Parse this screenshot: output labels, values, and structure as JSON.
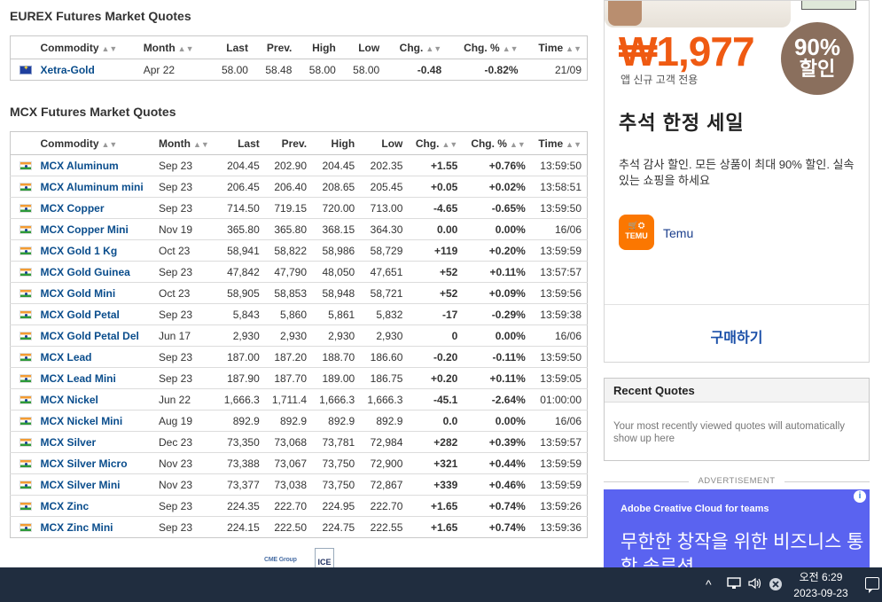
{
  "eurex": {
    "title": "EUREX Futures Market Quotes",
    "headers": {
      "commodity": "Commodity",
      "month": "Month",
      "last": "Last",
      "prev": "Prev.",
      "high": "High",
      "low": "Low",
      "chg": "Chg.",
      "chgpct": "Chg. %",
      "time": "Time"
    },
    "rows": [
      {
        "name": "Xetra-Gold",
        "month": "Apr 22",
        "last": "58.00",
        "prev": "58.48",
        "high": "58.00",
        "low": "58.00",
        "chg": "-0.48",
        "chgpct": "-0.82%",
        "time": "21/09",
        "dir": "down"
      }
    ]
  },
  "mcx": {
    "title": "MCX Futures Market Quotes",
    "headers": {
      "commodity": "Commodity",
      "month": "Month",
      "last": "Last",
      "prev": "Prev.",
      "high": "High",
      "low": "Low",
      "chg": "Chg.",
      "chgpct": "Chg. %",
      "time": "Time"
    },
    "rows": [
      {
        "name": "MCX Aluminum",
        "month": "Sep 23",
        "last": "204.45",
        "prev": "202.90",
        "high": "204.45",
        "low": "202.35",
        "chg": "+1.55",
        "chgpct": "+0.76%",
        "time": "13:59:50",
        "dir": "up"
      },
      {
        "name": "MCX Aluminum mini",
        "month": "Sep 23",
        "last": "206.45",
        "prev": "206.40",
        "high": "208.65",
        "low": "205.45",
        "chg": "+0.05",
        "chgpct": "+0.02%",
        "time": "13:58:51",
        "dir": "up"
      },
      {
        "name": "MCX Copper",
        "month": "Sep 23",
        "last": "714.50",
        "prev": "719.15",
        "high": "720.00",
        "low": "713.00",
        "chg": "-4.65",
        "chgpct": "-0.65%",
        "time": "13:59:50",
        "dir": "down"
      },
      {
        "name": "MCX Copper Mini",
        "month": "Nov 19",
        "last": "365.80",
        "prev": "365.80",
        "high": "368.15",
        "low": "364.30",
        "chg": "0.00",
        "chgpct": "0.00%",
        "time": "16/06",
        "dir": "flat"
      },
      {
        "name": "MCX Gold 1 Kg",
        "month": "Oct 23",
        "last": "58,941",
        "prev": "58,822",
        "high": "58,986",
        "low": "58,729",
        "chg": "+119",
        "chgpct": "+0.20%",
        "time": "13:59:59",
        "dir": "up"
      },
      {
        "name": "MCX Gold Guinea",
        "month": "Sep 23",
        "last": "47,842",
        "prev": "47,790",
        "high": "48,050",
        "low": "47,651",
        "chg": "+52",
        "chgpct": "+0.11%",
        "time": "13:57:57",
        "dir": "up"
      },
      {
        "name": "MCX Gold Mini",
        "month": "Oct 23",
        "last": "58,905",
        "prev": "58,853",
        "high": "58,948",
        "low": "58,721",
        "chg": "+52",
        "chgpct": "+0.09%",
        "time": "13:59:56",
        "dir": "up"
      },
      {
        "name": "MCX Gold Petal",
        "month": "Sep 23",
        "last": "5,843",
        "prev": "5,860",
        "high": "5,861",
        "low": "5,832",
        "chg": "-17",
        "chgpct": "-0.29%",
        "time": "13:59:38",
        "dir": "down"
      },
      {
        "name": "MCX Gold Petal Del",
        "month": "Jun 17",
        "last": "2,930",
        "prev": "2,930",
        "high": "2,930",
        "low": "2,930",
        "chg": "0",
        "chgpct": "0.00%",
        "time": "16/06",
        "dir": "flat"
      },
      {
        "name": "MCX Lead",
        "month": "Sep 23",
        "last": "187.00",
        "prev": "187.20",
        "high": "188.70",
        "low": "186.60",
        "chg": "-0.20",
        "chgpct": "-0.11%",
        "time": "13:59:50",
        "dir": "down"
      },
      {
        "name": "MCX Lead Mini",
        "month": "Sep 23",
        "last": "187.90",
        "prev": "187.70",
        "high": "189.00",
        "low": "186.75",
        "chg": "+0.20",
        "chgpct": "+0.11%",
        "time": "13:59:05",
        "dir": "up"
      },
      {
        "name": "MCX Nickel",
        "month": "Jun 22",
        "last": "1,666.3",
        "prev": "1,711.4",
        "high": "1,666.3",
        "low": "1,666.3",
        "chg": "-45.1",
        "chgpct": "-2.64%",
        "time": "01:00:00",
        "dir": "down"
      },
      {
        "name": "MCX Nickel Mini",
        "month": "Aug 19",
        "last": "892.9",
        "prev": "892.9",
        "high": "892.9",
        "low": "892.9",
        "chg": "0.0",
        "chgpct": "0.00%",
        "time": "16/06",
        "dir": "flat"
      },
      {
        "name": "MCX Silver",
        "month": "Dec 23",
        "last": "73,350",
        "prev": "73,068",
        "high": "73,781",
        "low": "72,984",
        "chg": "+282",
        "chgpct": "+0.39%",
        "time": "13:59:57",
        "dir": "up"
      },
      {
        "name": "MCX Silver Micro",
        "month": "Nov 23",
        "last": "73,388",
        "prev": "73,067",
        "high": "73,750",
        "low": "72,900",
        "chg": "+321",
        "chgpct": "+0.44%",
        "time": "13:59:59",
        "dir": "up"
      },
      {
        "name": "MCX Silver Mini",
        "month": "Nov 23",
        "last": "73,377",
        "prev": "73,038",
        "high": "73,750",
        "low": "72,867",
        "chg": "+339",
        "chgpct": "+0.46%",
        "time": "13:59:59",
        "dir": "up"
      },
      {
        "name": "MCX Zinc",
        "month": "Sep 23",
        "last": "224.35",
        "prev": "222.70",
        "high": "224.95",
        "low": "222.70",
        "chg": "+1.65",
        "chgpct": "+0.74%",
        "time": "13:59:26",
        "dir": "up"
      },
      {
        "name": "MCX Zinc Mini",
        "month": "Sep 23",
        "last": "224.15",
        "prev": "222.50",
        "high": "224.75",
        "low": "222.55",
        "chg": "+1.65",
        "chgpct": "+0.74%",
        "time": "13:59:36",
        "dir": "up"
      }
    ]
  },
  "logos": {
    "cme": "CME Group",
    "ice": "ICE"
  },
  "ad_temu": {
    "price": "₩1,977",
    "price_sub": "앱 신규 고객 전용",
    "badge_pct": "90%",
    "badge_off": "할인",
    "headline": "추석 한정 세일",
    "description": "추석 감사 할인. 모든 상품이 최대 90% 할인. 실속 있는 쇼핑을 하세요",
    "logo_text": "TEMU",
    "brand": "Temu",
    "cta": "구매하기",
    "brand_color": "#fb7701"
  },
  "recent_quotes": {
    "title": "Recent Quotes",
    "text": "Your most recently viewed quotes will automatically show up here"
  },
  "ad_adobe": {
    "label": "ADVERTISEMENT",
    "brand": "Adobe Creative Cloud for teams",
    "headline": "무한한 창작을 위한 비즈니스 통합 솔루션",
    "info": "i"
  },
  "taskbar": {
    "time": "오전 6:29",
    "date": "2023-09-23"
  }
}
